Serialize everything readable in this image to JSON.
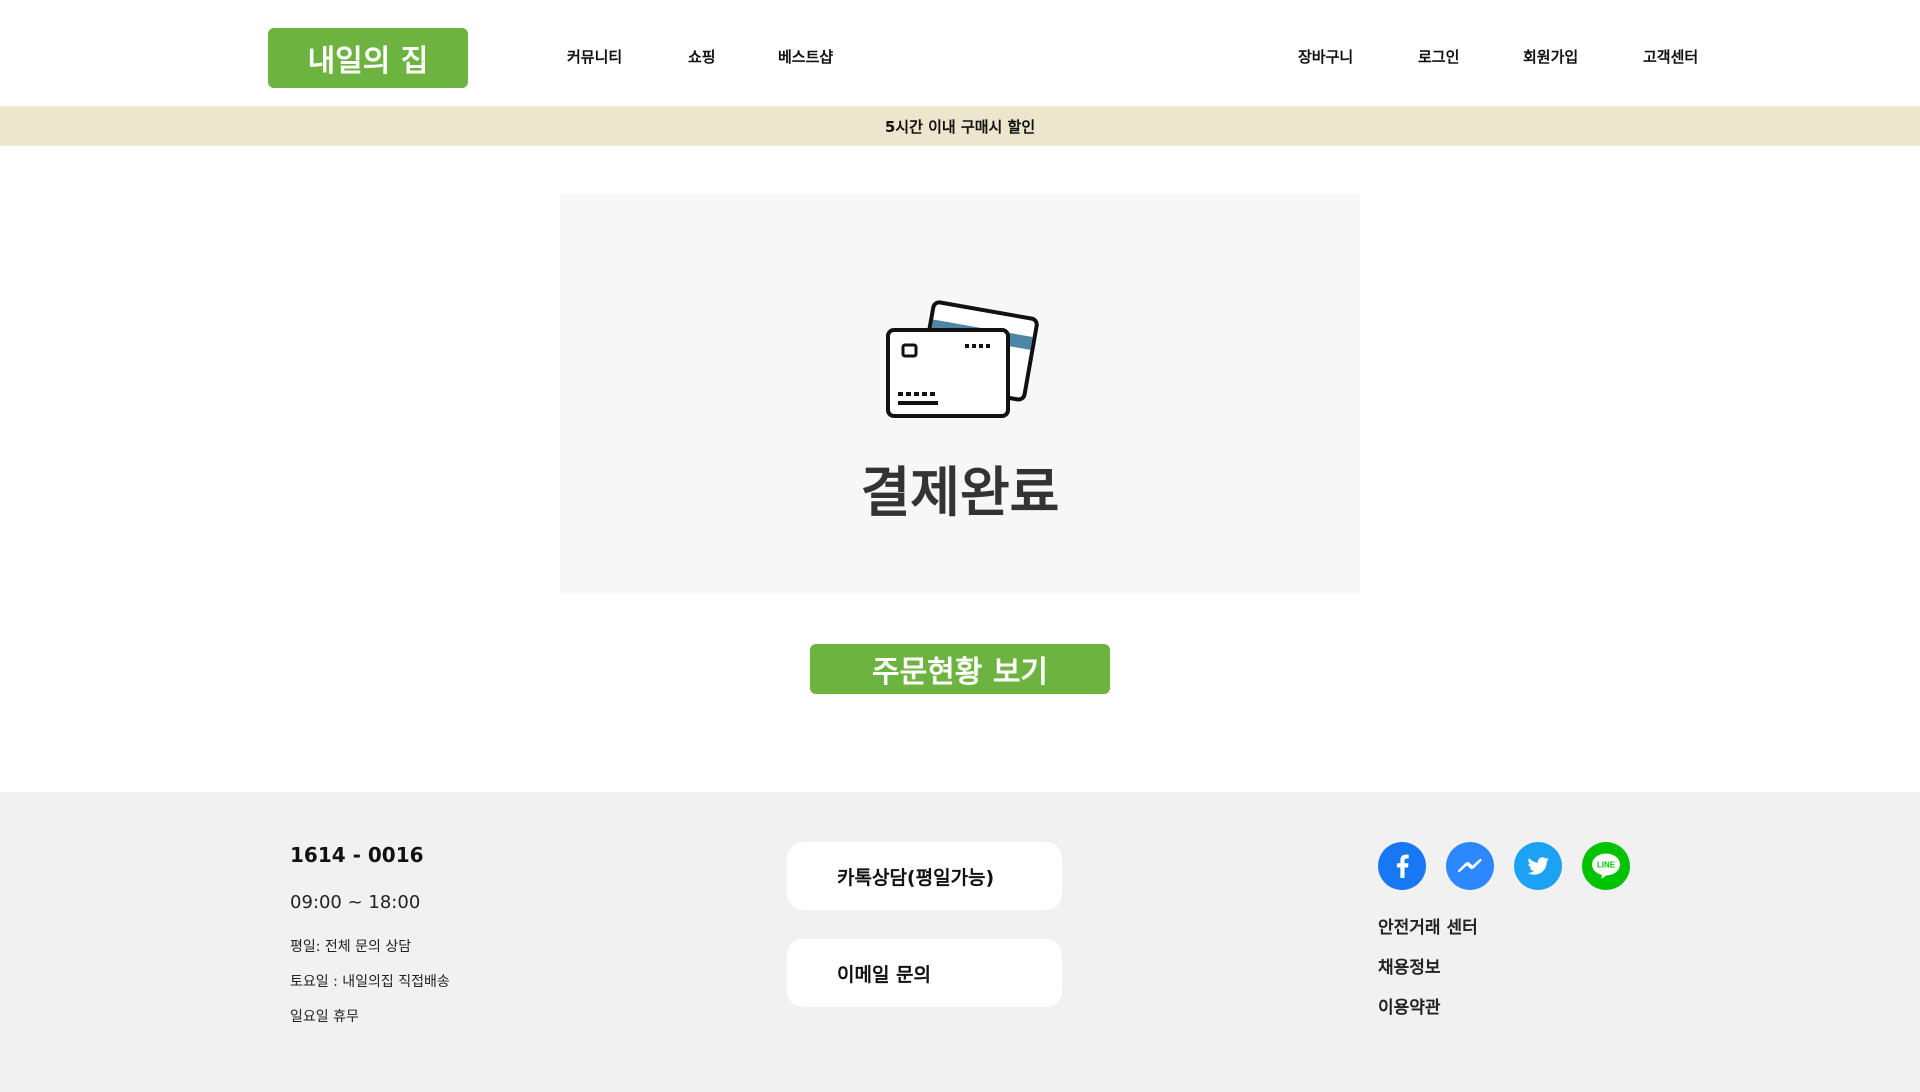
{
  "header": {
    "logo": "내일의 집",
    "nav_left": [
      "커뮤니티",
      "쇼핑",
      "베스트샵"
    ],
    "nav_right": [
      "장바구니",
      "로그인",
      "회원가입",
      "고객센터"
    ]
  },
  "promo": {
    "text": "5시간 이내 구매시 할인"
  },
  "main": {
    "icon": "credit-cards-icon",
    "title": "결제완료",
    "order_button": "주문현황 보기"
  },
  "footer": {
    "phone": "1614 - 0016",
    "hours": "09:00 ~ 18:00",
    "info": [
      "평일: 전체 문의 상담",
      "토요일 : 내일의집 직접배송",
      "일요일 휴무"
    ],
    "kakao_button": "카톡상담(평일가능)",
    "email_button": "이메일 문의",
    "social": [
      {
        "name": "facebook-icon",
        "color": "#1877f2"
      },
      {
        "name": "messenger-icon",
        "color": "#2d88ff"
      },
      {
        "name": "twitter-icon",
        "color": "#1da1f2"
      },
      {
        "name": "line-icon",
        "color": "#00c300"
      }
    ],
    "links": [
      "안전거래 센터",
      "채용정보",
      "이용약관"
    ]
  },
  "colors": {
    "accent": "#6db33f",
    "promo_bg": "#ede5cc",
    "footer_bg": "#f1f1f1",
    "box_bg": "#f7f7f7"
  }
}
